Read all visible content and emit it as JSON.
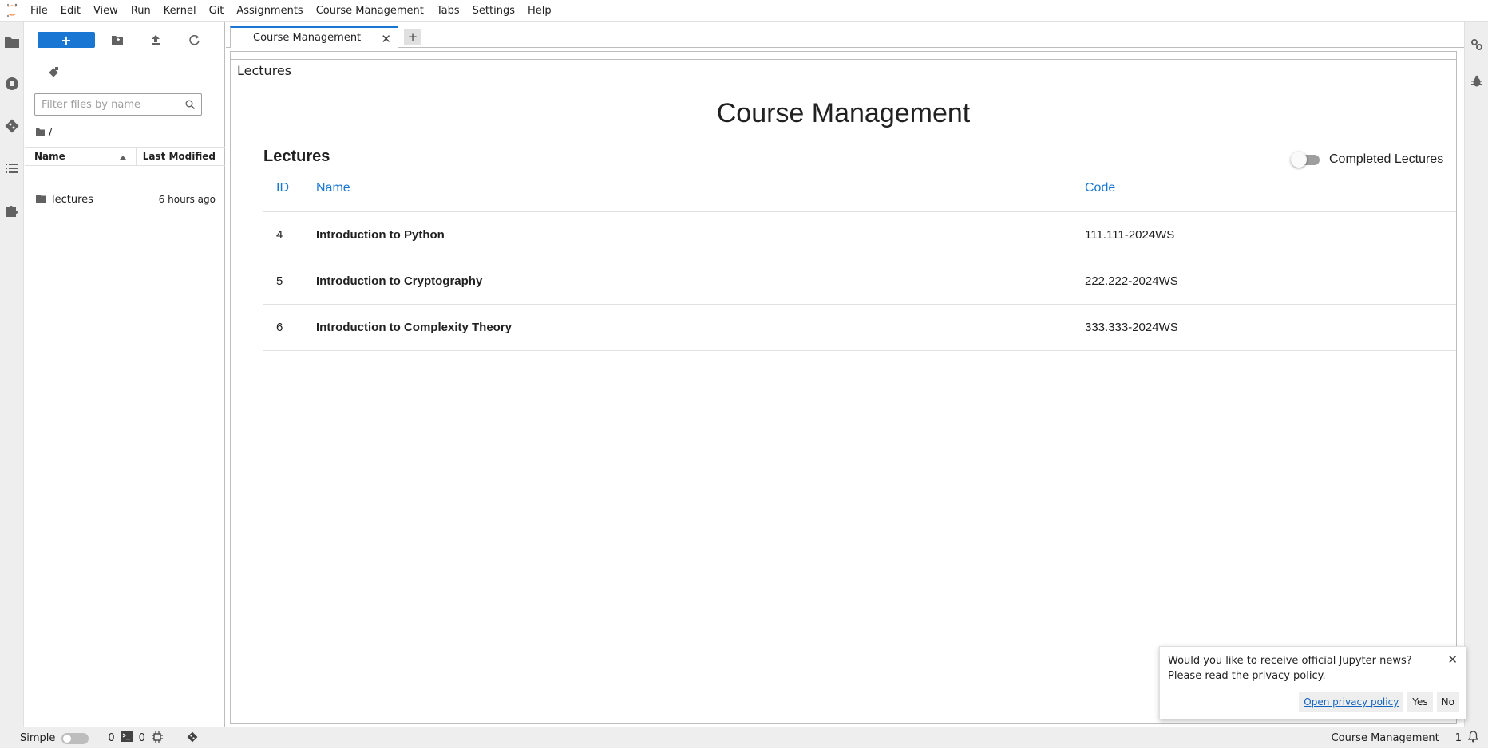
{
  "menubar": {
    "items": [
      "File",
      "Edit",
      "View",
      "Run",
      "Kernel",
      "Git",
      "Assignments",
      "Course Management",
      "Tabs",
      "Settings",
      "Help"
    ]
  },
  "colors": {
    "accent": "#1976d2",
    "logo_orange": "#f37726",
    "link": "#1565c0"
  },
  "filebrowser": {
    "search_placeholder": "Filter files by name",
    "breadcrumb": "/",
    "col_name": "Name",
    "col_modified": "Last Modified",
    "items": [
      {
        "name": "lectures",
        "modified": "6 hours ago",
        "icon": "folder-icon"
      }
    ]
  },
  "tabs": [
    {
      "label": "Course Management",
      "active": true
    }
  ],
  "course": {
    "breadcrumb": "Lectures",
    "title": "Course Management",
    "section_title": "Lectures",
    "toggle_label": "Completed Lectures",
    "toggle_on": false,
    "table": {
      "headers": {
        "id": "ID",
        "name": "Name",
        "code": "Code"
      },
      "rows": [
        {
          "id": "4",
          "name": "Introduction to Python",
          "code": "111.111-2024WS"
        },
        {
          "id": "5",
          "name": "Introduction to Cryptography",
          "code": "222.222-2024WS"
        },
        {
          "id": "6",
          "name": "Introduction to Complexity Theory",
          "code": "333.333-2024WS"
        }
      ]
    }
  },
  "notification": {
    "line1": "Would you like to receive official Jupyter news?",
    "line2": "Please read the privacy policy.",
    "link": "Open privacy policy",
    "yes": "Yes",
    "no": "No"
  },
  "statusbar": {
    "mode_label": "Simple",
    "kernels": "0",
    "terminals": "0",
    "right_label": "Course Management",
    "notification_count": "1"
  }
}
